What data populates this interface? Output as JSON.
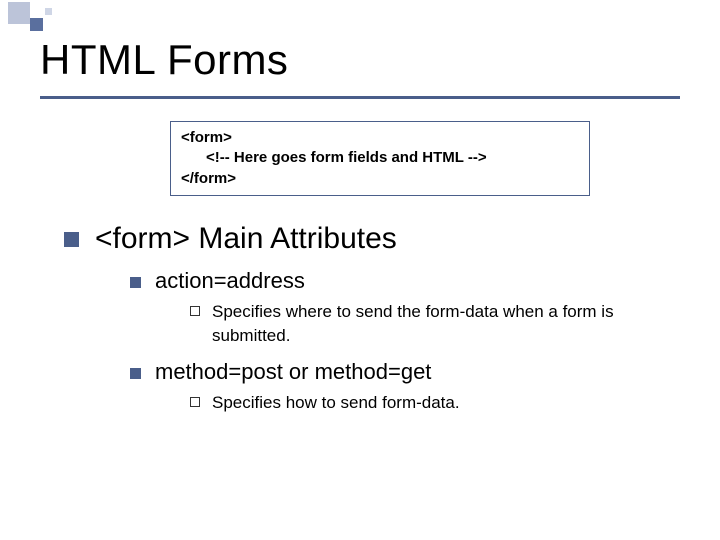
{
  "title": "HTML Forms",
  "codebox": "<form>\n      <!-- Here goes form fields and HTML -->\n</form>",
  "lvl1": {
    "text": "<form> Main Attributes"
  },
  "items": [
    {
      "label": "action=address",
      "desc": "Specifies where to send the form-data when a form is submitted."
    },
    {
      "label_pre": "method=post",
      "label_mid": " or ",
      "label_post": "method=get",
      "desc": "Specifies how to send form-data."
    }
  ]
}
